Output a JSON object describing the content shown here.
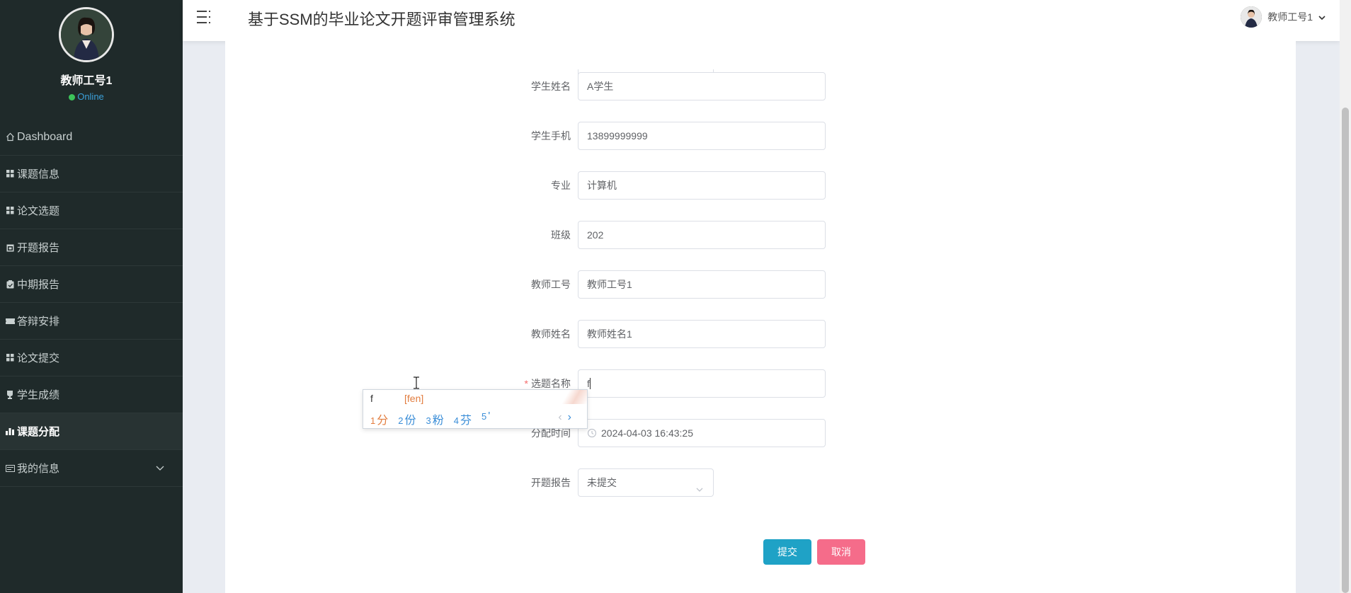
{
  "sidebar": {
    "user_name": "教师工号1",
    "status": "Online",
    "items": [
      {
        "label": "Dashboard",
        "icon": "home-icon"
      },
      {
        "label": "课题信息",
        "icon": "grid-icon"
      },
      {
        "label": "论文选题",
        "icon": "grid-icon"
      },
      {
        "label": "开题报告",
        "icon": "calendar-icon"
      },
      {
        "label": "中期报告",
        "icon": "clipboard-icon"
      },
      {
        "label": "答辩安排",
        "icon": "ticket-icon"
      },
      {
        "label": "论文提交",
        "icon": "grid-icon"
      },
      {
        "label": "学生成绩",
        "icon": "trophy-icon"
      },
      {
        "label": "课题分配",
        "icon": "bar-chart-icon",
        "active": true
      },
      {
        "label": "我的信息",
        "icon": "id-card-icon"
      }
    ]
  },
  "header": {
    "title": "基于SSM的毕业论文开题评审管理系统",
    "user": "教师工号1"
  },
  "form": {
    "fields": [
      {
        "label": "学生姓名",
        "value": "A学生"
      },
      {
        "label": "学生手机",
        "value": "13899999999"
      },
      {
        "label": "专业",
        "value": "计算机"
      },
      {
        "label": "班级",
        "value": "202"
      },
      {
        "label": "教师工号",
        "value": "教师工号1"
      },
      {
        "label": "教师姓名",
        "value": "教师姓名1"
      }
    ],
    "topic": {
      "label": "选题名称",
      "value": "f",
      "required_mark": "*"
    },
    "assign_time": {
      "label": "分配时间",
      "value": "2024-04-03 16:43:25"
    },
    "report": {
      "label": "开题报告",
      "value": "未提交"
    },
    "submit_label": "提交",
    "cancel_label": "取消"
  },
  "ime": {
    "typed": "f",
    "pinyin": "[fen]",
    "candidates": [
      {
        "num": "1",
        "text": "分"
      },
      {
        "num": "2",
        "text": "份"
      },
      {
        "num": "3",
        "text": "粉"
      },
      {
        "num": "4",
        "text": "芬"
      },
      {
        "num": "5",
        "text": "'"
      }
    ],
    "prev": "‹",
    "next": "›"
  },
  "colors": {
    "sidebar_bg": "#1f2a2a",
    "submit": "#1fa2c6",
    "cancel": "#f56c8a",
    "online_dot": "#3cc35a"
  }
}
